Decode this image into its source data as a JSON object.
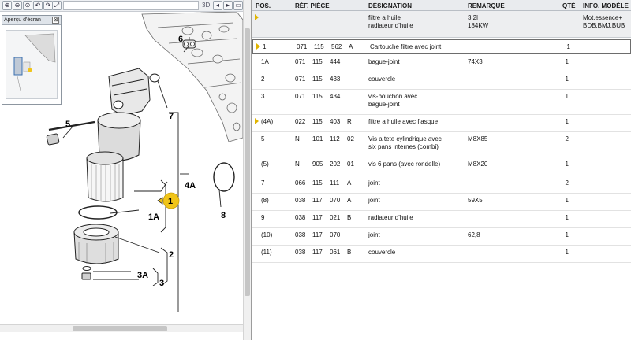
{
  "overview": {
    "title": "Aperçu d'écran",
    "close": "⊠"
  },
  "toolbar": {
    "view_3d": "3D",
    "buttons": [
      "⊕",
      "⊖",
      "⊙",
      "↶",
      "↷",
      "⤢"
    ]
  },
  "diagram_labels": {
    "l1": "1",
    "l1a": "1A",
    "l2": "2",
    "l3": "3",
    "l3a": "3A",
    "l4a": "4A",
    "l5": "5",
    "l6": "6",
    "l7": "7",
    "l8": "8"
  },
  "table": {
    "headers": {
      "pos": "POS.",
      "ref": "RÉF. PIÈCE",
      "des": "DÉSIGNATION",
      "rem": "REMARQUE",
      "qty": "QTÉ",
      "mod": "INFO. MODÈLE"
    },
    "group": {
      "des1": "filtre a huile",
      "des2": "radiateur d'huile",
      "rem1": "3,2l",
      "rem2": "184KW",
      "mod1": "Mot.essence+",
      "mod2": "BDB,BMJ,BUB"
    },
    "rows": [
      {
        "pos": "1",
        "r1": "071",
        "r2": "115",
        "r3": "562",
        "r4": "A",
        "des": "Cartouche filtre avec joint",
        "des2": "",
        "rem": "",
        "qty": "1"
      },
      {
        "pos": "1A",
        "r1": "071",
        "r2": "115",
        "r3": "444",
        "r4": "",
        "des": "bague-joint",
        "des2": "",
        "rem": "74X3",
        "qty": "1"
      },
      {
        "pos": "2",
        "r1": "071",
        "r2": "115",
        "r3": "433",
        "r4": "",
        "des": "couvercle",
        "des2": "",
        "rem": "",
        "qty": "1"
      },
      {
        "pos": "3",
        "r1": "071",
        "r2": "115",
        "r3": "434",
        "r4": "",
        "des": "vis-bouchon avec",
        "des2": "bague-joint",
        "rem": "",
        "qty": "1"
      },
      {
        "pos": "(4A)",
        "r1": "022",
        "r2": "115",
        "r3": "403",
        "r4": "R",
        "des": "filtre a huile avec flasque",
        "des2": "",
        "rem": "",
        "qty": "1"
      },
      {
        "pos": "5",
        "r1": "N",
        "r2": "101",
        "r3": "112",
        "r4": "02",
        "des": "Vis a tete cylindrique avec",
        "des2": "six pans internes (combi)",
        "rem": "M8X85",
        "qty": "2"
      },
      {
        "pos": "(5)",
        "r1": "N",
        "r2": "905",
        "r3": "202",
        "r4": "01",
        "des": "vis 6 pans (avec rondelle)",
        "des2": "",
        "rem": "M8X20",
        "qty": "1"
      },
      {
        "pos": "7",
        "r1": "066",
        "r2": "115",
        "r3": "111",
        "r4": "A",
        "des": "joint",
        "des2": "",
        "rem": "",
        "qty": "2"
      },
      {
        "pos": "(8)",
        "r1": "038",
        "r2": "117",
        "r3": "070",
        "r4": "A",
        "des": "joint",
        "des2": "",
        "rem": "59X5",
        "qty": "1"
      },
      {
        "pos": "9",
        "r1": "038",
        "r2": "117",
        "r3": "021",
        "r4": "B",
        "des": "radiateur d'huile",
        "des2": "",
        "rem": "",
        "qty": "1"
      },
      {
        "pos": "(10)",
        "r1": "038",
        "r2": "117",
        "r3": "070",
        "r4": "",
        "des": "joint",
        "des2": "",
        "rem": "62,8",
        "qty": "1"
      },
      {
        "pos": "(11)",
        "r1": "038",
        "r2": "117",
        "r3": "061",
        "r4": "B",
        "des": "couvercle",
        "des2": "",
        "rem": "",
        "qty": "1"
      }
    ]
  },
  "colors": {
    "marker": "#e0b400",
    "callout": "#f0c419",
    "selected_border": "#6d6d6d"
  }
}
